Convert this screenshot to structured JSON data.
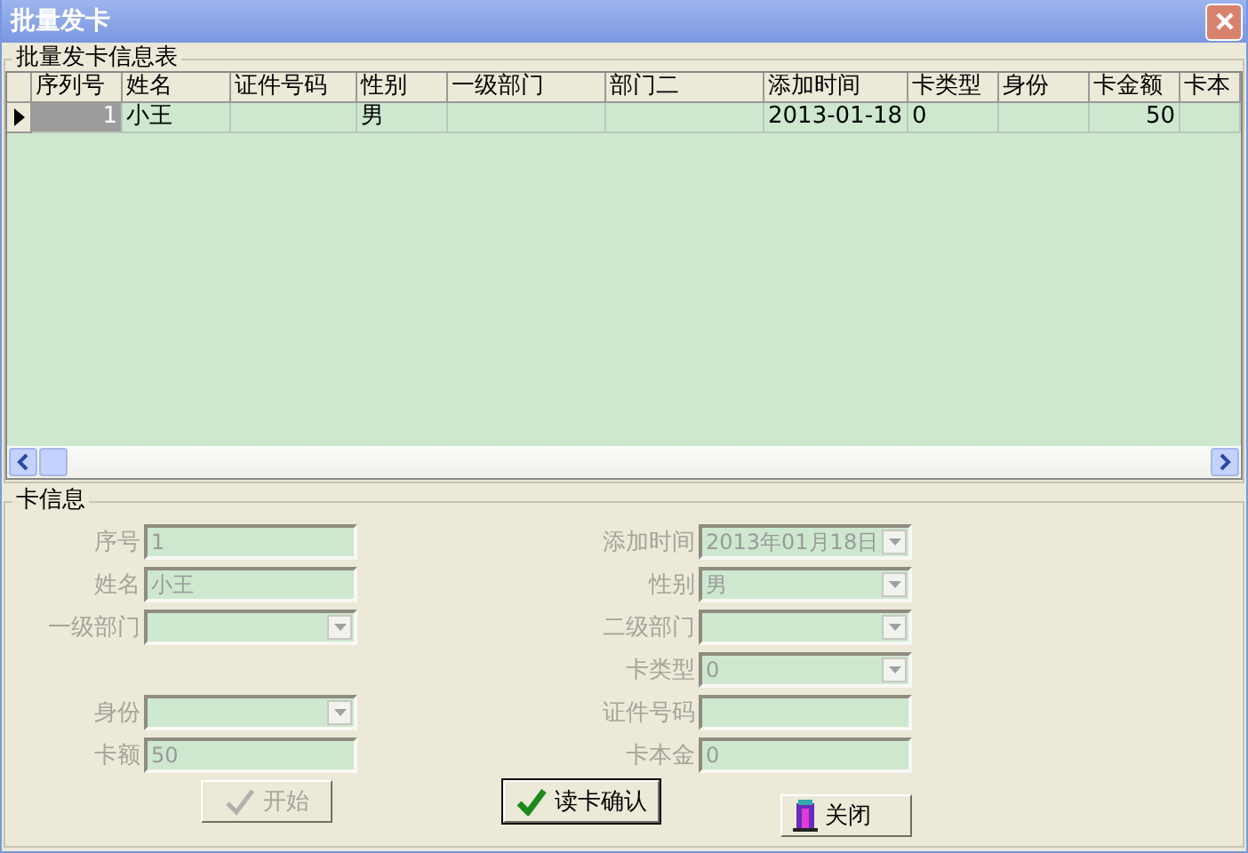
{
  "window": {
    "title": "批量发卡"
  },
  "table_group": {
    "title": "批量发卡信息表"
  },
  "table": {
    "columns": [
      "序列号",
      "姓名",
      "证件号码",
      "性别",
      "一级部门",
      "部门二",
      "添加时间",
      "卡类型",
      "身份",
      "卡金额",
      "卡本"
    ],
    "rows": [
      {
        "selected": true,
        "cells": [
          "1",
          "小王",
          "",
          "男",
          "",
          "",
          "2013-01-18",
          "0",
          "",
          "50",
          ""
        ]
      }
    ]
  },
  "form_group": {
    "title": "卡信息"
  },
  "left_fields": [
    {
      "label": "序号",
      "kind": "text",
      "value": "1",
      "disabled": true
    },
    {
      "label": "姓名",
      "kind": "text",
      "value": "小王",
      "disabled": true
    },
    {
      "label": "一级部门",
      "kind": "select",
      "disabled": true
    },
    {
      "kind": "blank"
    },
    {
      "label": "身份",
      "kind": "select",
      "disabled": true
    },
    {
      "label": "卡额",
      "kind": "text",
      "value": "50",
      "disabled": true
    }
  ],
  "right_fields": [
    {
      "label": "添加时间",
      "kind": "select",
      "value": "2013年01月18日",
      "disabled": true
    },
    {
      "label": "性别",
      "kind": "select",
      "value": "男",
      "disabled": true
    },
    {
      "label": "二级部门",
      "kind": "select",
      "disabled": true
    },
    {
      "label": "卡类型",
      "kind": "select",
      "value": "0",
      "disabled": true
    },
    {
      "label": "证件号码",
      "kind": "text",
      "disabled": true
    },
    {
      "label": "卡本金",
      "kind": "text",
      "value": "0",
      "disabled": true
    }
  ],
  "buttons": [
    {
      "label": "开始",
      "kind": "start",
      "disabled": true
    },
    {
      "label": "读卡确认",
      "kind": "confirm",
      "disabled": false
    },
    {
      "label": "关闭",
      "kind": "close",
      "disabled": false
    }
  ]
}
